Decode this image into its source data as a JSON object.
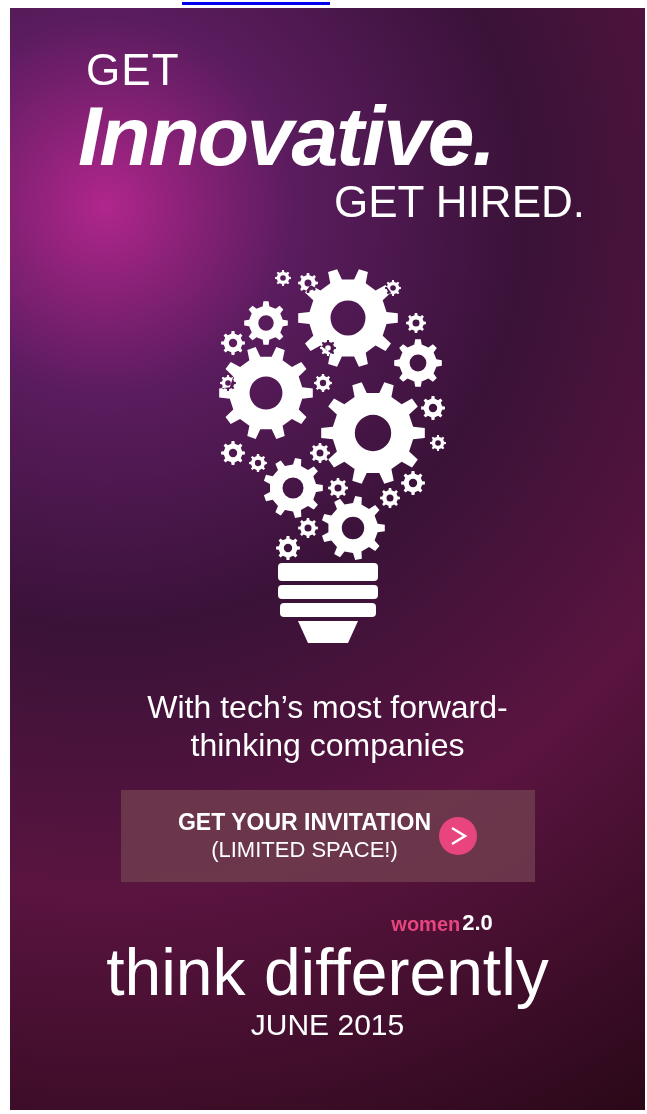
{
  "banner": {
    "headline_top": "GET",
    "headline_main": "Innovative.",
    "headline_bottom": "GET HIRED.",
    "tagline": "With tech’s most forward-thinking companies",
    "cta": {
      "title": "GET YOUR INVITATION",
      "subtitle": "(LIMITED SPACE!)"
    },
    "brand_mark": "women",
    "brand_version": "2.0",
    "slogan": "think differently",
    "date": "JUNE 2015"
  }
}
